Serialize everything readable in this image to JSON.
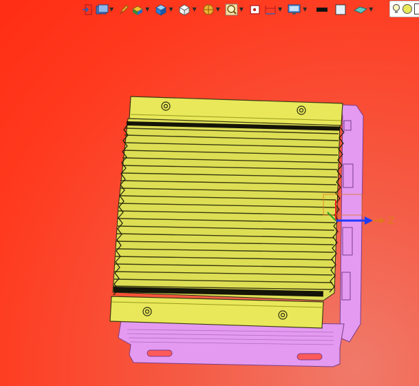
{
  "window": {
    "width": 609,
    "height": 560
  },
  "toolbar": {
    "buttons": [
      {
        "name": "exit-sketch-button",
        "icon": "exit-icon",
        "has_dropdown": false
      },
      {
        "name": "view-orientation-button",
        "icon": "view-orientation-icon",
        "has_dropdown": true
      },
      {
        "name": "edit-appearance-button",
        "icon": "pencil-icon",
        "has_dropdown": false
      },
      {
        "name": "apply-scene-button",
        "icon": "scene-icon",
        "has_dropdown": true
      },
      {
        "name": "display-style-button",
        "icon": "shaded-cube-icon",
        "has_dropdown": true
      },
      {
        "name": "hide-show-items-button",
        "icon": "wireframe-cube-icon",
        "has_dropdown": true
      },
      {
        "name": "section-view-button",
        "icon": "section-view-icon",
        "has_dropdown": true
      },
      {
        "name": "zoom-button",
        "icon": "zoom-icon",
        "has_dropdown": true
      },
      {
        "name": "zoom-to-area-button",
        "icon": "zoom-area-icon",
        "has_dropdown": false
      },
      {
        "name": "dimension-button",
        "icon": "dimension-icon",
        "has_dropdown": true
      },
      {
        "name": "monitor-settings-button",
        "icon": "monitor-icon",
        "has_dropdown": true
      },
      {
        "name": "line-color-button",
        "icon": "black-swatch-icon",
        "has_dropdown": false
      },
      {
        "name": "background-color-button",
        "icon": "white-swatch-icon",
        "has_dropdown": false
      },
      {
        "name": "cloud-button",
        "icon": "cloud-icon",
        "has_dropdown": true
      }
    ],
    "lights_box": {
      "icons": [
        "lightbulb-icon",
        "sphere-icon"
      ]
    }
  },
  "axis": {
    "label": "Z"
  },
  "colors": {
    "background": "#ff3a1e",
    "part_yellow": "#e8e85a",
    "part_yellow_dark": "#9a9a1c",
    "chassis_pink": "#e39af0",
    "chassis_pink_dark": "#b06cc0",
    "axis_blue": "#1e3cff",
    "axis_orange": "#e07a18",
    "axis_green": "#2aa02a"
  }
}
